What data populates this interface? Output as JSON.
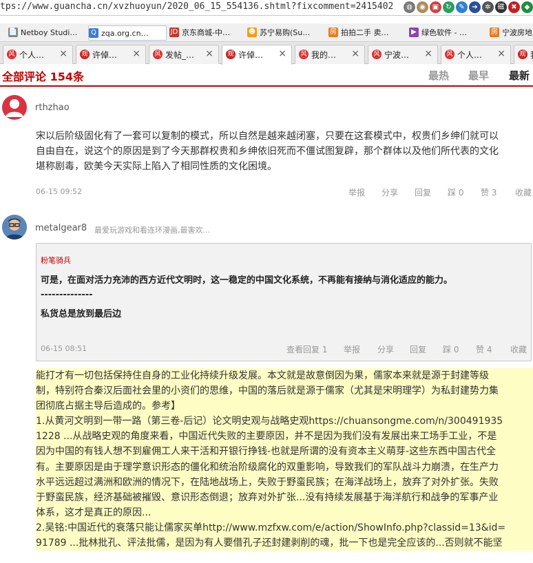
{
  "browser": {
    "address": "tps://www.guancha.cn/xvzhuoyun/2020_06_15_554136.shtml?fixcomment=2415402",
    "addr_icons": [
      {
        "name": "globe-icon",
        "glyph": "◍",
        "color": "#7a7a7a"
      },
      {
        "name": "profile-icon",
        "glyph": "◉",
        "color": "#b08c5a"
      },
      {
        "name": "app-icon",
        "glyph": "▣",
        "color": "#d24040"
      },
      {
        "name": "sync-icon",
        "glyph": "↻",
        "color": "#2aa060"
      },
      {
        "name": "share-icon",
        "glyph": "✎",
        "color": "#3080d0"
      },
      {
        "name": "forward-icon",
        "glyph": "➔",
        "color": "#2b4f9a"
      },
      {
        "name": "gear-icon",
        "glyph": "✲",
        "color": "#555555"
      },
      {
        "name": "magnet-label",
        "glyph": "磁",
        "color": "#333333"
      },
      {
        "name": "stop-icon",
        "glyph": "✖",
        "color": "#c62020"
      },
      {
        "name": "extension-icon",
        "glyph": "◆",
        "color": "#1f8f3f"
      }
    ],
    "bookmarks": [
      {
        "label": "Netboy Studi…",
        "icon": "📄",
        "color": "#888888"
      },
      {
        "label": "zqa.org.cn…",
        "icon": "Q",
        "color": "#3a7bd5",
        "active": true
      },
      {
        "label": "京东商城-中…",
        "icon": "JD",
        "color": "#c0392b"
      },
      {
        "label": "苏宁易购(Su…",
        "icon": "☻",
        "color": "#f39c12"
      },
      {
        "label": "拍拍二手 卖…",
        "icon": "房",
        "color": "#e67e22"
      },
      {
        "label": "绿色软件 - …",
        "icon": "▶",
        "color": "#8e44ad"
      },
      {
        "label": "宁波房地",
        "icon": "房",
        "color": "#e67e22"
      }
    ],
    "tabs": [
      {
        "label": "个人…",
        "icon": "风",
        "color": "#d33"
      },
      {
        "label": "许倬…",
        "icon": "观",
        "color": "#c22"
      },
      {
        "label": "发帖_…",
        "icon": "风",
        "color": "#d33"
      },
      {
        "label": "许倬…",
        "icon": "观",
        "color": "#c22",
        "active": true
      },
      {
        "label": "我的…",
        "icon": "风",
        "color": "#d33"
      },
      {
        "label": "宁波…",
        "icon": "风",
        "color": "#d33"
      },
      {
        "label": "个人…",
        "icon": "风",
        "color": "#d33"
      },
      {
        "label": "我",
        "icon": "观",
        "color": "#c22"
      }
    ]
  },
  "comments_header": {
    "title": "全部评论 154条",
    "sort_hot": "最热",
    "sort_early": "最早",
    "sort_new": "最新"
  },
  "comment1": {
    "username": "rthzhao",
    "lines": [
      "宋以后阶级固化有了一套可以复制的模式，所以自然是越来越闭塞，只要在这套模式中，权贵们乡绅们就可以",
      "自由自在，说这个的原因是到了今天那群权贵和乡绅依旧死而不僵试图复辟，那个群体以及他们所代表的文化",
      "堪称剧毒，欧美今天实际上陷入了相同性质的文化困境。"
    ],
    "time": "06-15 09:52",
    "actions": {
      "report": "举报",
      "share": "分享",
      "reply": "回复",
      "down": "踩 0",
      "up": "赞 3",
      "fav": "收藏"
    }
  },
  "comment2": {
    "username": "metalgear8",
    "signature": "最爱玩游戏和看连环漫画,最害欢...",
    "quote": {
      "author": "粉笔骑兵",
      "line1": "可是，在面对活力充沛的西方近代文明时，这一稳定的中国文化系统，不再能有接纳与消化适应的能力。",
      "line2": "--------------",
      "line3": "私货总是放到最后边",
      "time": "06-15 08:51",
      "actions": {
        "view": "查看回复 1",
        "report": "举报",
        "share": "分享",
        "reply": "回复",
        "down": "踩 0",
        "up": "赞 4",
        "fav": "收藏"
      }
    },
    "body": [
      "能打才有一切包括保持住自身的工业化持续升级发展。本文就是故意倒因为果，儒家本来就是源于封建等级",
      "制，特别符合秦汉后面社会里的小资们的思维，中国的落后就是源于儒家（尤其是宋明理学）为私封建势力集",
      "团彻底占据主导后造成的。参考】",
      "1.从黄河文明到一带一路（第三卷-后记）论文明史观与战略史观https://chuansongme.com/n/300491935",
      "1228 ...从战略史观的角度来看，中国近代失败的主要原因，并不是因为我们没有发展出来工场手工业，不是",
      "因为中国的有钱人想不到雇佣工人来干活和开银行挣钱-也就是所谓的没有资本主义萌芽-这些东西中国古代全",
      "有。主要原因是由于理学意识形态的僵化和统治阶级腐化的双重影响，导致我们的军队战斗力崩溃，在生产力",
      "水平远远超过满洲和欧洲的情况下，在陆地战场上，失败于野蛮民族；在海洋战场上，放弃了对外扩张。失败",
      "于野蛮民族，经济基础被摧毁、意识形态倒退；放弃对外扩张...没有持续发展基于海洋航行和战争的军事产业",
      "体系，这才是真正的原因...",
      "2.吴铭:中国近代的衰落只能让儒家买单http://www.mzfxw.com/e/action/ShowInfo.php?classid=13&id=",
      "91789 ...批林批孔、评法批儒，是因为有人要借孔子还封建剥削的魂，批一下也是完全应该的...否则就不能坚"
    ]
  }
}
